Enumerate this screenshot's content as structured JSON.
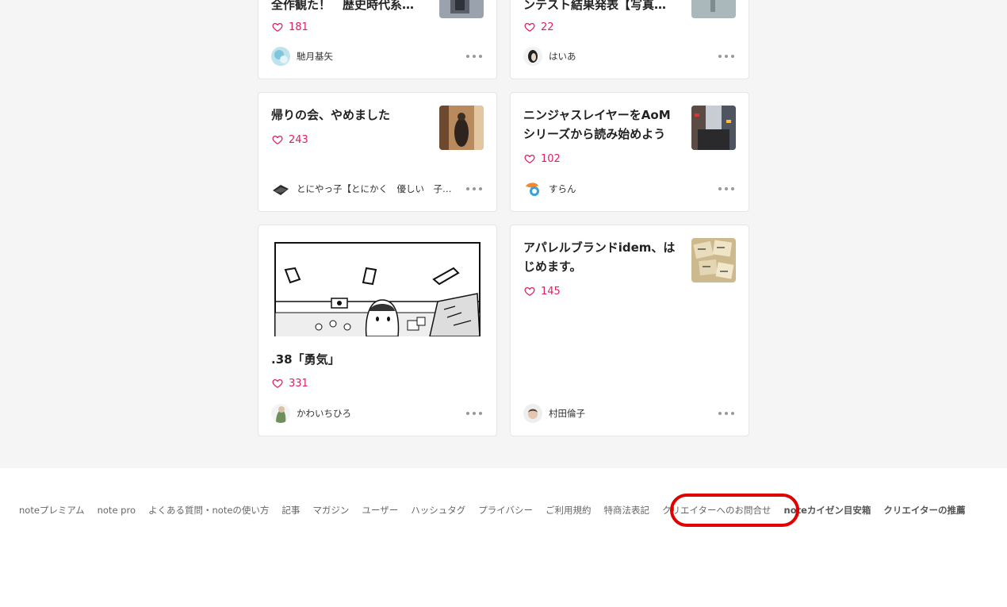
{
  "cards": [
    {
      "title": "全作観た！　歴史時代系…",
      "likes": "181",
      "author": "馳月基矢"
    },
    {
      "title": "ンテスト結果発表【写真…",
      "likes": "22",
      "author": "はいあ"
    },
    {
      "title": "帰りの会、やめました",
      "likes": "243",
      "author": "とにやっ子【とにかく　優しい　子…"
    },
    {
      "title_lines": [
        "ニンジャスレイヤーをAoM",
        "シリーズから読み始めよう"
      ],
      "likes": "102",
      "author": "すらん"
    },
    {
      "title": ".38「勇気」",
      "likes": "331",
      "author": "かわいちひろ"
    },
    {
      "title_lines": [
        "アパレルブランドidem、は",
        "じめます。"
      ],
      "likes": "145",
      "author": "村田倫子"
    }
  ],
  "icons": {
    "like": "heart-outline-icon",
    "more": "more-horizontal-icon"
  },
  "colors": {
    "like": "#e2205d",
    "highlight": "#e00000",
    "background": "#f5f5f5"
  },
  "footer": {
    "links": [
      "noteプレミアム",
      "note pro",
      "よくある質問・noteの使い方",
      "記事",
      "マガジン",
      "ユーザー",
      "ハッシュタグ",
      "プライバシー",
      "ご利用規約",
      "特商法表記",
      "クリエイターへのお問合せ",
      "noteカイゼン目安箱",
      "クリエイターの推薦"
    ]
  }
}
